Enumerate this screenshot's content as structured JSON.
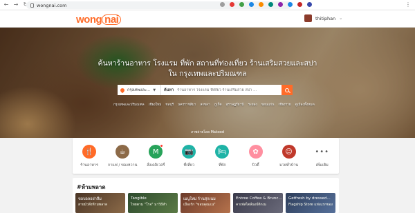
{
  "browser": {
    "url": "wongnai.com",
    "extension_colors": [
      "#9e9e9e",
      "#e53935",
      "#43a047",
      "#1e88e5",
      "#fb8c00",
      "#00897b",
      "#8e24aa",
      "#1e88e5",
      "#c62828",
      "#3949ab"
    ]
  },
  "header": {
    "logo_a": "wong",
    "logo_b": "nai",
    "brand_color": "#ff6b28",
    "user_name": "thitiphan"
  },
  "hero": {
    "title_line1": "ค้นหาร้านอาหาร โรงแรม ที่พัก สถานที่ท่องเที่ยว ร้านเสริมสวยและสปา",
    "title_line2": "ใน กรุงเทพและปริมณฑล",
    "location_value": "กรุงเทพและ...",
    "keyword_label": "ค้นหา",
    "keyword_placeholder": "ร้านอาหาร โรงแรม ที่เที่ยว ร้านเสริมสวย สปา ...",
    "cities": [
      "กรุงเทพและปริมณฑล",
      "เชียงใหม่",
      "ชลบุรี",
      "นครราชสีมา",
      "สงขลา",
      "ภูเก็ต",
      "สุราษฎร์ธานี",
      "ระยอง",
      "ขอนแก่น",
      "เชียงราย",
      "ดูเมืองทั้งหมด"
    ],
    "photo_credit": "ภาพถ่ายโดย Makood"
  },
  "categories": [
    {
      "label": "ร้านอาหาร",
      "icon": "fork-knife-icon",
      "glyph": "🍴",
      "color": "orange"
    },
    {
      "label": "กาแฟ / ของหวาน",
      "icon": "coffee-icon",
      "glyph": "☕",
      "color": "brown"
    },
    {
      "label": "สั่งเดลิเวอรี่",
      "icon": "delivery-icon",
      "glyph": "M",
      "color": "green"
    },
    {
      "label": "ที่เที่ยว",
      "icon": "camera-icon",
      "glyph": "📷",
      "color": "teal"
    },
    {
      "label": "ที่พัก",
      "icon": "bed-icon",
      "glyph": "🛏",
      "color": "teal"
    },
    {
      "label": "บิวตี้",
      "icon": "beauty-icon",
      "glyph": "✿",
      "color": "pink"
    },
    {
      "label": "มวยทั่วบ้าน",
      "icon": "chef-icon",
      "glyph": "☺",
      "color": "darkred"
    },
    {
      "label": "เพิ่มเติม",
      "icon": "more-icon",
      "glyph": "•••",
      "color": "more"
    }
  ],
  "section": {
    "title": "#ห้ามพลาด",
    "tiles": [
      {
        "line1": "ขอบอลอย่าลืม",
        "line2": "สายมัวสิ่งห้ามพลาด"
      },
      {
        "line1": "Tangible",
        "line2": "ไทยตาม \"โรจ\" มาวิถีสำ"
      },
      {
        "line1": "เมนูใหม่ ร้านสุกเนม",
        "line2": "เมืองรัก \"ขอบคุณแน\""
      },
      {
        "line1": "Entree Coffee & Brunc...",
        "line2": "คาเฟ่สไตล์นอร์ดิกเน"
      },
      {
        "line1": "Getfresh by dressed...",
        "line2": "Flagship Store แห่งแรกของ"
      }
    ]
  }
}
